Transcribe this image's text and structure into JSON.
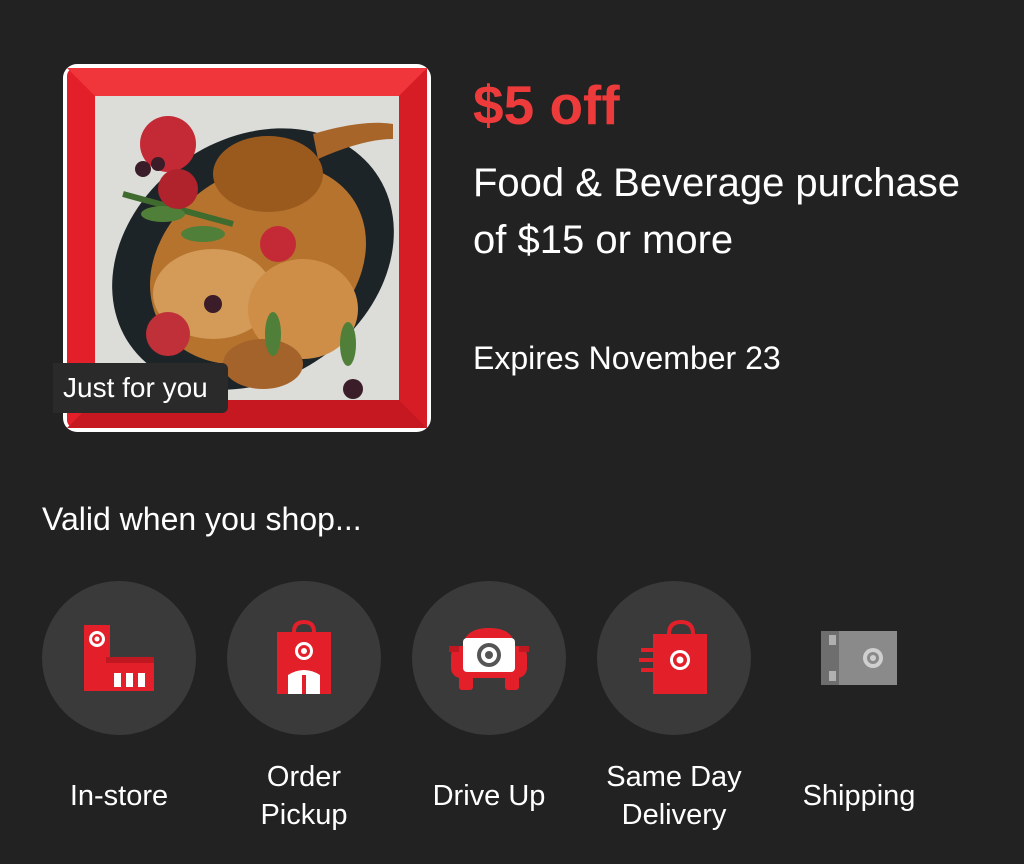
{
  "offer": {
    "amount": "$5 off",
    "description": "Food & Beverage purchase of $15 or more",
    "expires": "Expires November 23",
    "badge": "Just for you"
  },
  "valid_section": {
    "heading": "Valid when you shop...",
    "methods": [
      {
        "label": "In-store",
        "icon": "store-icon"
      },
      {
        "label": "Order Pickup",
        "icon": "shopping-bag-icon"
      },
      {
        "label": "Drive Up",
        "icon": "car-icon"
      },
      {
        "label": "Same Day Delivery",
        "icon": "delivery-bag-icon"
      },
      {
        "label": "Shipping",
        "icon": "package-icon"
      }
    ]
  },
  "colors": {
    "background": "#222222",
    "accent_red": "#ed3b3b",
    "circle_bg": "#3a3a3a"
  }
}
